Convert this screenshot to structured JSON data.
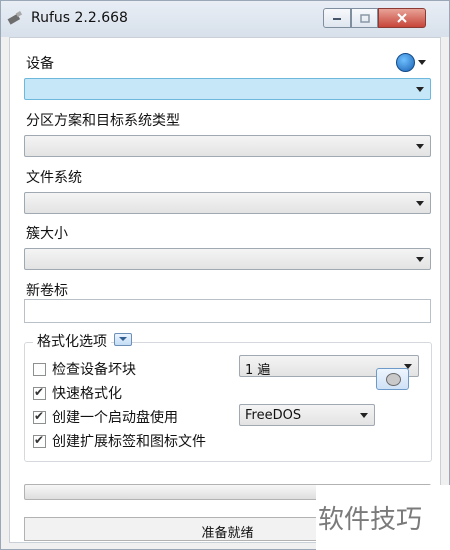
{
  "window": {
    "title": "Rufus 2.2.668"
  },
  "sections": {
    "device_label": "设备",
    "partition_label": "分区方案和目标系统类型",
    "filesystem_label": "文件系统",
    "cluster_label": "簇大小",
    "volume_label": "新卷标"
  },
  "format_options": {
    "title": "格式化选项",
    "check_bad_blocks": "检查设备坏块",
    "passes": "1 遍",
    "quick_format": "快速格式化",
    "create_bootable": "创建一个启动盘使用",
    "boot_type": "FreeDOS",
    "extended_label": "创建扩展标签和图标文件"
  },
  "status": "准备就绪",
  "watermark": "软件技巧",
  "icons": {
    "app": "usb-drive-icon",
    "language": "globe-icon",
    "disk_image": "disk-image-icon"
  },
  "colors": {
    "device_combo": "#c6e7f7",
    "close_button": "#c7453a"
  }
}
